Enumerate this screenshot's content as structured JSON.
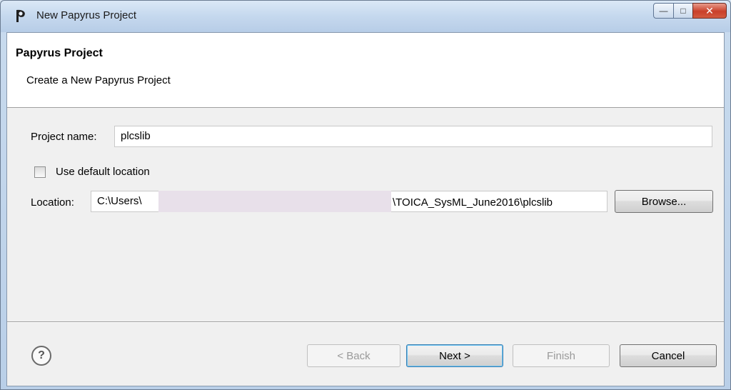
{
  "window": {
    "title": "New Papyrus Project"
  },
  "banner": {
    "title": "Papyrus Project",
    "description": "Create a New Papyrus Project"
  },
  "form": {
    "project_name_label": "Project name:",
    "project_name_value": "plcslib",
    "use_default_location_label": "Use default location",
    "use_default_location_checked": false,
    "location_label": "Location:",
    "location_value_prefix": "C:\\Users\\",
    "location_value_suffix": "\\TOICA_SysML_June2016\\plcslib",
    "browse_label": "Browse..."
  },
  "footer": {
    "back_label": "< Back",
    "next_label": "Next >",
    "finish_label": "Finish",
    "cancel_label": "Cancel"
  },
  "icons": {
    "app": "papyrus-logo-icon",
    "help": "help-icon",
    "minimize": "minimize-icon",
    "maximize": "maximize-icon",
    "close": "close-icon"
  }
}
